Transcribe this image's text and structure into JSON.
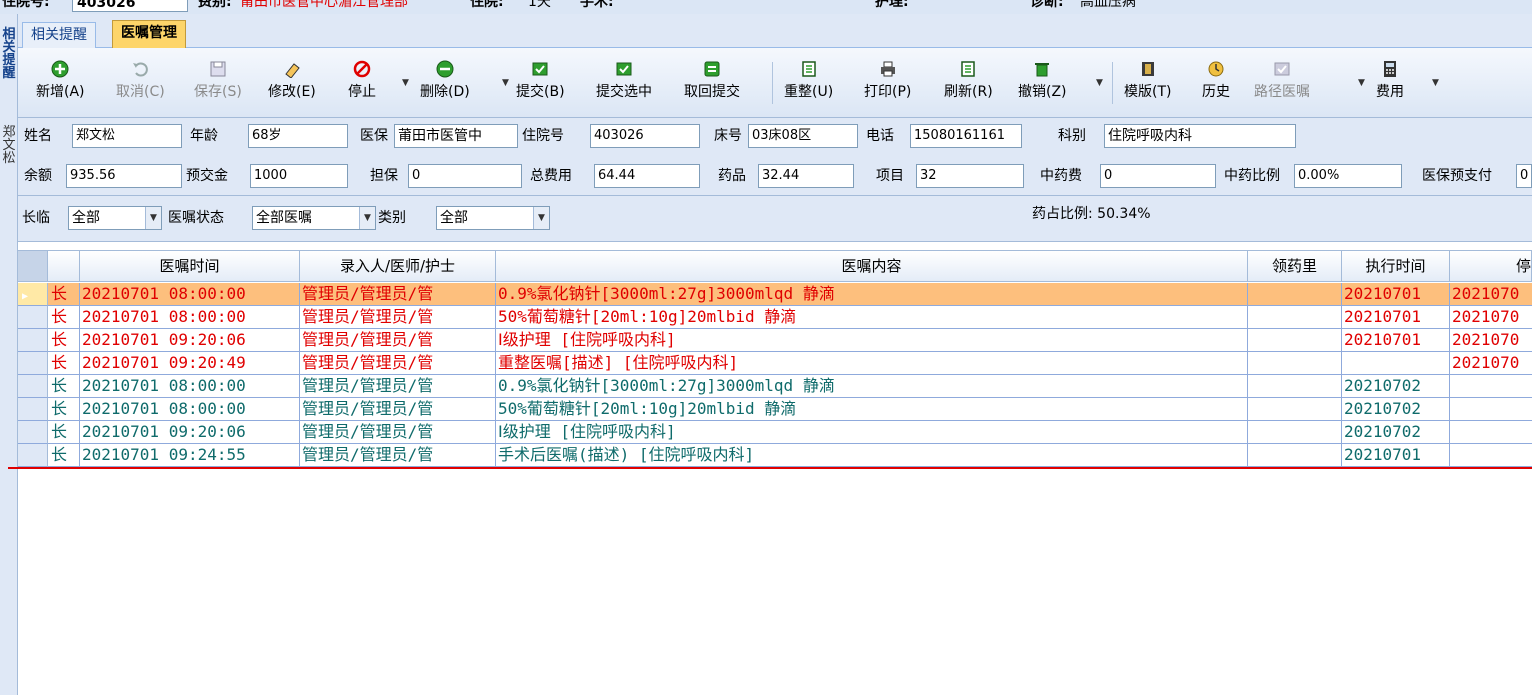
{
  "patient_bar": {
    "inpatient_no_label": "住院号:",
    "inpatient_no": "403026",
    "fee_type_label": "费别:",
    "fee_type": "莆田市医管中心湄江管理部",
    "inpatient_label": "住院:",
    "inpatient_days": "1天",
    "surgery_label": "手术:",
    "nursing_label": "护理:",
    "diagnosis_label": "诊断:",
    "diagnosis": "高血压病"
  },
  "left_strip": {
    "tab1": "相关提醒",
    "patient_name": "郑文松"
  },
  "tabs": [
    {
      "label": "相关提醒",
      "active": false
    },
    {
      "label": "医嘱管理",
      "active": true
    }
  ],
  "toolbar": {
    "buttons": [
      {
        "label": "新增(A)",
        "icon": "add-icon",
        "disabled": false
      },
      {
        "label": "取消(C)",
        "icon": "undo-icon",
        "disabled": true
      },
      {
        "label": "保存(S)",
        "icon": "save-icon",
        "disabled": true
      },
      {
        "label": "修改(E)",
        "icon": "eraser-icon",
        "disabled": false
      },
      {
        "label": "停止",
        "icon": "stop-icon",
        "disabled": false
      },
      {
        "label": "删除(D)",
        "icon": "delete-icon",
        "disabled": false
      },
      {
        "label": "提交(B)",
        "icon": "submit-icon",
        "disabled": false
      },
      {
        "label": "提交选中",
        "icon": "submit-selected-icon",
        "disabled": false
      },
      {
        "label": "取回提交",
        "icon": "retrieve-icon",
        "disabled": false
      },
      {
        "label": "重整(U)",
        "icon": "reorganize-icon",
        "disabled": false
      },
      {
        "label": "打印(P)",
        "icon": "print-icon",
        "disabled": false
      },
      {
        "label": "刷新(R)",
        "icon": "refresh-icon",
        "disabled": false
      },
      {
        "label": "撤销(Z)",
        "icon": "trash-icon",
        "disabled": false
      },
      {
        "label": "模版(T)",
        "icon": "template-icon",
        "disabled": false
      },
      {
        "label": "历史",
        "icon": "history-icon",
        "disabled": false
      },
      {
        "label": "路径医嘱",
        "icon": "path-orders-icon",
        "disabled": true
      },
      {
        "label": "费用",
        "icon": "calculator-icon",
        "disabled": false
      }
    ]
  },
  "info": {
    "name_label": "姓名",
    "name": "郑文松",
    "age_label": "年龄",
    "age": "68岁",
    "insurance_label": "医保",
    "insurance": "莆田市医管中",
    "inpatient_no_label": "住院号",
    "inpatient_no": "403026",
    "bed_label": "床号",
    "bed": "03床08区",
    "phone_label": "电话",
    "phone": "15080161161",
    "dept_label": "科别",
    "dept": "住院呼吸内科",
    "balance_label": "余额",
    "balance": "935.56",
    "deposit_label": "预交金",
    "deposit": "1000",
    "guarantee_label": "担保",
    "guarantee": "0",
    "total_fee_label": "总费用",
    "total_fee": "64.44",
    "drug_label": "药品",
    "drug": "32.44",
    "item_label": "项目",
    "item": "32",
    "tcm_fee_label": "中药费",
    "tcm_fee": "0",
    "tcm_ratio_label": "中药比例",
    "tcm_ratio": "0.00%",
    "ins_prepay_label": "医保预支付",
    "ins_prepay": "0"
  },
  "filters": {
    "term_label": "长临",
    "term_value": "全部",
    "status_label": "医嘱状态",
    "status_value": "全部医嘱",
    "category_label": "类别",
    "category_value": "全部",
    "drug_ratio": "药占比例: 50.34%"
  },
  "grid": {
    "columns": [
      "医嘱时间",
      "录入人/医师/护士",
      "医嘱内容",
      "领药里",
      "执行时间",
      "停"
    ],
    "rows": [
      {
        "type": "长",
        "time": "20210701 08:00:00",
        "entry": "管理员/管理员/管",
        "content": "0.9%氯化钠针[3000ml:27g]3000mlqd 静滴",
        "qty": "",
        "exec": "20210701",
        "stop": "2021070",
        "color": "red",
        "selected": true
      },
      {
        "type": "长",
        "time": "20210701 08:00:00",
        "entry": "管理员/管理员/管",
        "content": "50%葡萄糖针[20ml:10g]20mlbid 静滴",
        "qty": "",
        "exec": "20210701",
        "stop": "2021070",
        "color": "red",
        "selected": false
      },
      {
        "type": "长",
        "time": "20210701 09:20:06",
        "entry": "管理员/管理员/管",
        "content": "Ⅰ级护理   [住院呼吸内科]",
        "qty": "",
        "exec": "20210701",
        "stop": "2021070",
        "color": "red",
        "selected": false
      },
      {
        "type": "长",
        "time": "20210701 09:20:49",
        "entry": "管理员/管理员/管",
        "content": "重整医嘱[描述]   [住院呼吸内科]",
        "qty": "",
        "exec": "",
        "stop": "2021070",
        "color": "red",
        "selected": false
      },
      {
        "type": "长",
        "time": "20210701 08:00:00",
        "entry": "管理员/管理员/管",
        "content": "0.9%氯化钠针[3000ml:27g]3000mlqd 静滴",
        "qty": "",
        "exec": "20210702",
        "stop": "",
        "color": "teal",
        "selected": false
      },
      {
        "type": "长",
        "time": "20210701 08:00:00",
        "entry": "管理员/管理员/管",
        "content": "50%葡萄糖针[20ml:10g]20mlbid 静滴",
        "qty": "",
        "exec": "20210702",
        "stop": "",
        "color": "teal",
        "selected": false
      },
      {
        "type": "长",
        "time": "20210701 09:20:06",
        "entry": "管理员/管理员/管",
        "content": "Ⅰ级护理   [住院呼吸内科]",
        "qty": "",
        "exec": "20210702",
        "stop": "",
        "color": "teal",
        "selected": false
      },
      {
        "type": "长",
        "time": "20210701 09:24:55",
        "entry": "管理员/管理员/管",
        "content": "手术后医嘱(描述)   [住院呼吸内科]",
        "qty": "",
        "exec": "20210701",
        "stop": "",
        "color": "teal",
        "selected": false
      }
    ]
  },
  "colors": {
    "red_text": "#e00000",
    "teal_text": "#0f6b6b",
    "selected_row": "#fdbf7d",
    "active_tab": "#fdd56a"
  }
}
